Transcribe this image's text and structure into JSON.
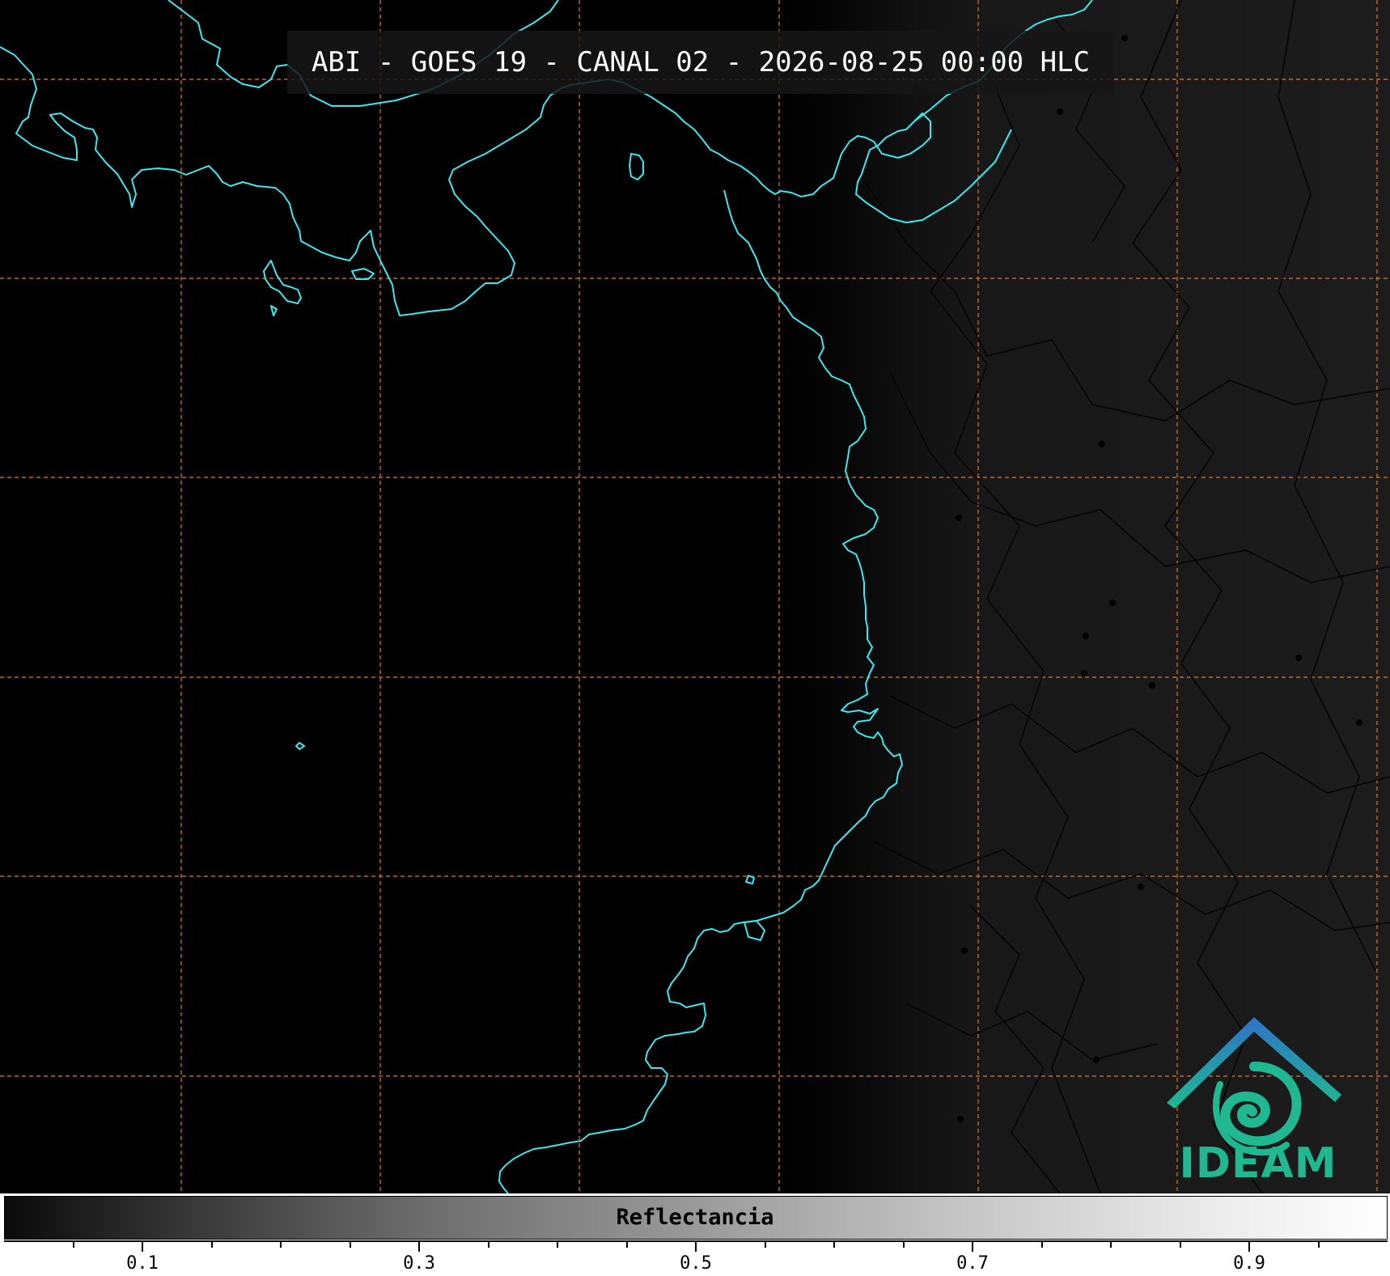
{
  "title": "ABI - GOES 19 - CANAL 02 - 2026-08-25 00:00 HLC",
  "logo": {
    "text": "IDEAM"
  },
  "colorbar": {
    "label": "Reflectancia",
    "range": [
      0.0,
      1.0
    ],
    "major_ticks": [
      {
        "value": 0.1,
        "label": "0.1"
      },
      {
        "value": 0.3,
        "label": "0.3"
      },
      {
        "value": 0.5,
        "label": "0.5"
      },
      {
        "value": 0.7,
        "label": "0.7"
      },
      {
        "value": 0.9,
        "label": "0.9"
      }
    ],
    "minor_ticks": [
      0.05,
      0.15,
      0.2,
      0.25,
      0.35,
      0.4,
      0.45,
      0.55,
      0.6,
      0.65,
      0.75,
      0.8,
      0.85,
      0.95
    ]
  },
  "colors": {
    "coastline": "#3ee6ee",
    "gridlines": "#c0692a",
    "borders": "#050505",
    "logo_teal": "#1fb890",
    "logo_blue": "#2f73c8"
  }
}
